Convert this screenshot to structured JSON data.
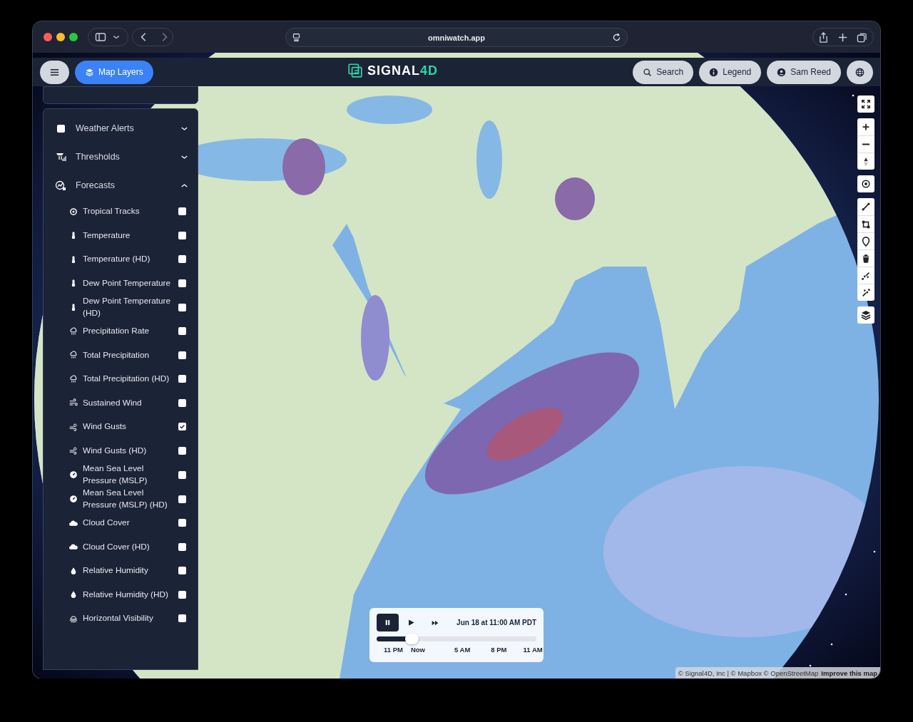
{
  "browser": {
    "url": "omniwatch.app"
  },
  "app_bar": {
    "buttons": [
      {
        "kind": "menu",
        "selected": false
      },
      {
        "kind": "layers",
        "label": "Map Layers",
        "selected": true
      }
    ],
    "logo": {
      "text": "SIGNAL",
      "accent": "4D"
    },
    "right_buttons": [
      {
        "kind": "search",
        "label": "Search"
      },
      {
        "kind": "legend",
        "label": "Legend"
      },
      {
        "kind": "user",
        "label": "Sam Reed"
      },
      {
        "kind": "globe"
      }
    ]
  },
  "layers_panel": {
    "sections": [
      {
        "title": "Weather Alerts",
        "kind": "checkbox",
        "checked": false,
        "expanded": false
      },
      {
        "title": "Thresholds",
        "kind": "icon",
        "expanded": false
      },
      {
        "title": "Forecasts",
        "kind": "icon",
        "expanded": true,
        "items": [
          {
            "label": "Tropical Tracks",
            "checked": false
          },
          {
            "label": "Temperature",
            "checked": false
          },
          {
            "label": "Temperature (HD)",
            "checked": false
          },
          {
            "label": "Dew Point Temperature",
            "checked": false
          },
          {
            "label": "Dew Point Temperature (HD)",
            "checked": false
          },
          {
            "label": "Precipitation Rate",
            "checked": false
          },
          {
            "label": "Total Precipitation",
            "checked": false
          },
          {
            "label": "Total Precipitation (HD)",
            "checked": false
          },
          {
            "label": "Sustained Wind",
            "checked": false
          },
          {
            "label": "Wind Gusts",
            "checked": true
          },
          {
            "label": "Wind Gusts (HD)",
            "checked": false
          },
          {
            "label": "Mean Sea Level Pressure (MSLP)",
            "checked": false
          },
          {
            "label": "Mean Sea Level Pressure (MSLP) (HD)",
            "checked": false
          },
          {
            "label": "Cloud Cover",
            "checked": false
          },
          {
            "label": "Cloud Cover (HD)",
            "checked": false
          },
          {
            "label": "Relative Humidity",
            "checked": false
          },
          {
            "label": "Relative Humidity (HD)",
            "checked": false
          },
          {
            "label": "Horizontal Visibility",
            "checked": false
          }
        ]
      }
    ]
  },
  "timeline": {
    "controls": [
      {
        "kind": "pause",
        "selected": true
      },
      {
        "kind": "play",
        "selected": false
      },
      {
        "kind": "fast-forward",
        "selected": false
      }
    ],
    "datetime": "Jun 18 at 11:00 AM PDT",
    "level": 0.22,
    "ticks": [
      "11 PM",
      "Now",
      "5 AM",
      "8 PM",
      "11 AM"
    ]
  },
  "attribution": {
    "text": "© Signal4D, Inc | © Mapbox © OpenStreetMap",
    "link": "Improve this map"
  }
}
